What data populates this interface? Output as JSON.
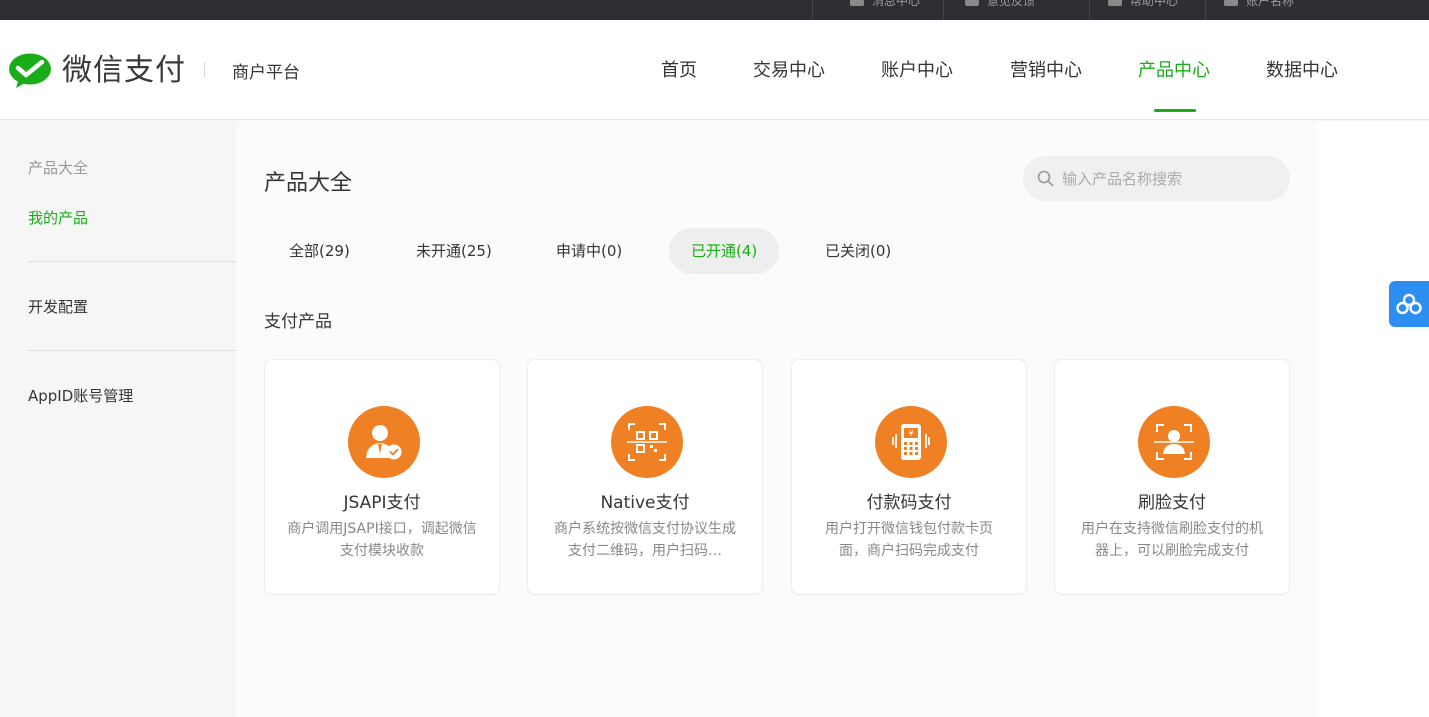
{
  "topbar": {
    "items": [
      "消息中心",
      "意见反馈",
      "帮助中心",
      "账户名称"
    ]
  },
  "header": {
    "logo_text": "微信支付",
    "platform_label": "商户平台",
    "nav": [
      "首页",
      "交易中心",
      "账户中心",
      "营销中心",
      "产品中心",
      "数据中心"
    ],
    "active_nav": "产品中心"
  },
  "sidebar": {
    "items": [
      {
        "label": "产品大全",
        "state": "muted"
      },
      {
        "label": "我的产品",
        "state": "active"
      },
      {
        "label": "开发配置",
        "state": "normal"
      },
      {
        "label": "AppID账号管理",
        "state": "normal"
      }
    ]
  },
  "main": {
    "title": "产品大全",
    "search_placeholder": "输入产品名称搜索",
    "tabs": [
      {
        "label": "全部(29)"
      },
      {
        "label": "未开通(25)"
      },
      {
        "label": "申请中(0)"
      },
      {
        "label": "已开通(4)"
      },
      {
        "label": "已关闭(0)"
      }
    ],
    "active_tab": "已开通(4)",
    "section_title": "支付产品",
    "products": [
      {
        "name": "JSAPI支付",
        "desc": "商户调用JSAPI接口，调起微信支付模块收款",
        "icon": "user-check-icon"
      },
      {
        "name": "Native支付",
        "desc": "商户系统按微信支付协议生成支付二维码，用户扫码…",
        "icon": "qr-scan-icon"
      },
      {
        "name": "付款码支付",
        "desc": "用户打开微信钱包付款卡页面，商户扫码完成支付",
        "icon": "pos-terminal-icon"
      },
      {
        "name": "刷脸支付",
        "desc": "用户在支持微信刷脸支付的机器上，可以刷脸完成支付",
        "icon": "face-scan-icon"
      }
    ]
  },
  "colors": {
    "brand_green": "#1aad19",
    "product_orange": "#f08024",
    "float_blue": "#2b8ef0"
  }
}
